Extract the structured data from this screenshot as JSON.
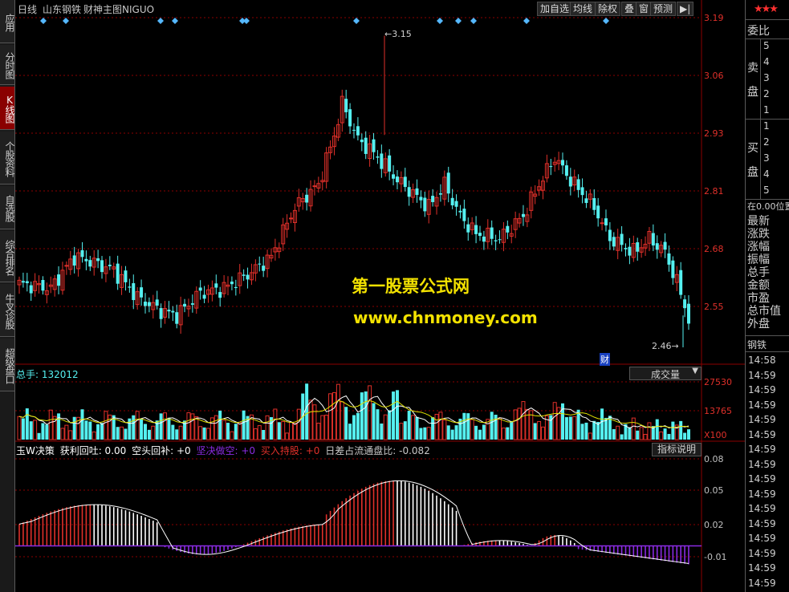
{
  "left_tabs": [
    {
      "label": "应用",
      "active": false
    },
    {
      "label": "分时图",
      "active": false
    },
    {
      "label": "K线图",
      "active": true
    },
    {
      "label": "个股资料",
      "active": false
    },
    {
      "label": "自选股",
      "active": false
    },
    {
      "label": "综合排名",
      "active": false
    },
    {
      "label": "牛叉诊股",
      "active": false
    },
    {
      "label": "超级盘口",
      "active": false
    }
  ],
  "topbar": {
    "period": "日线",
    "stock_name": "山东钢铁",
    "indicator_name": "财神主图NIGUO",
    "buttons": [
      "加自选",
      "均线",
      "除权",
      "叠",
      "窗",
      "预测"
    ],
    "play_glyph": "▶|"
  },
  "price_axis": [
    "3.19",
    "3.06",
    "2.93",
    "2.81",
    "2.68",
    "2.55"
  ],
  "annotations": {
    "high": "3.15",
    "low": "2.46",
    "cai_marker": "财"
  },
  "watermark": {
    "title": "第一股票公式网",
    "url": "www.chnmoney.com"
  },
  "volume_panel": {
    "total_label": "总手: 132012",
    "selector": "成交量",
    "axis": [
      "27530",
      "13765",
      "X100"
    ]
  },
  "indicator_panel": {
    "items": [
      {
        "text": "玉W决策",
        "color": "#ffffff"
      },
      {
        "text": "获利回吐: 0.00",
        "color": "#ffffff"
      },
      {
        "text": "空头回补: +0",
        "color": "#ffffff"
      },
      {
        "text": "坚决做空: +0",
        "color": "#8a2be2"
      },
      {
        "text": "买入持股: +0",
        "color": "#e0302a"
      },
      {
        "text": "日差占流通盘比: -0.082",
        "color": "#c8c8c8"
      }
    ],
    "help_button": "指标说明",
    "axis": [
      "0.08",
      "0.05",
      "0.02",
      "-0.01"
    ]
  },
  "right_panel": {
    "stars": "★★★",
    "weibi": "委比",
    "sell_label": "卖盘",
    "buy_label": "买盘",
    "sell_levels": [
      "5",
      "4",
      "3",
      "2",
      "1"
    ],
    "buy_levels": [
      "1",
      "2",
      "3",
      "4",
      "5"
    ],
    "position": "在0.00位置",
    "fields": [
      "最新",
      "涨跌",
      "涨幅",
      "振幅",
      "总手",
      "金额",
      "市盈",
      "总市值",
      "外盘"
    ],
    "sector": "钢铁",
    "times": [
      "14:58",
      "14:59",
      "14:59",
      "14:59",
      "14:59",
      "14:59",
      "14:59",
      "14:59",
      "14:59",
      "14:59",
      "14:59",
      "14:59",
      "14:59",
      "14:59",
      "14:59",
      "14:59"
    ]
  },
  "colors": {
    "up": "#e0302a",
    "down": "#55f0f0",
    "grid": "#8b0000",
    "ma_white": "#ffffff",
    "purple": "#8a2be2",
    "diamond": "#55b8ff",
    "watermark": "#f3e200"
  }
}
